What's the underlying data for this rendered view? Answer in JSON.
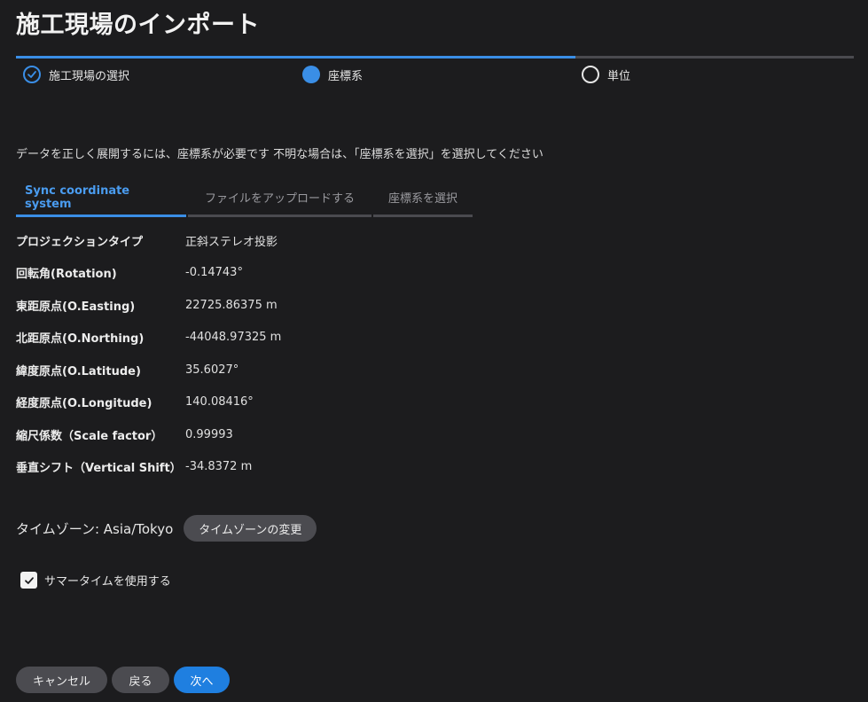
{
  "title": "施工現場のインポート",
  "steps": [
    {
      "label": "施工現場の選択",
      "state": "done"
    },
    {
      "label": "座標系",
      "state": "active"
    },
    {
      "label": "単位",
      "state": "pending"
    }
  ],
  "instruction": "データを正しく展開するには、座標系が必要です 不明な場合は、「座標系を選択」を選択してください",
  "tabs": [
    {
      "label": "Sync coordinate system",
      "active": true
    },
    {
      "label": "ファイルをアップロードする",
      "active": false
    },
    {
      "label": "座標系を選択",
      "active": false
    }
  ],
  "properties": [
    {
      "label": "プロジェクションタイプ",
      "value": "正斜ステレオ投影"
    },
    {
      "label": "回転角(Rotation)",
      "value": "-0.14743°"
    },
    {
      "label": "東距原点(O.Easting)",
      "value": "22725.86375 m"
    },
    {
      "label": "北距原点(O.Northing)",
      "value": "-44048.97325 m"
    },
    {
      "label": "緯度原点(O.Latitude)",
      "value": "35.6027°"
    },
    {
      "label": "経度原点(O.Longitude)",
      "value": "140.08416°"
    },
    {
      "label": "縮尺係数（Scale factor）",
      "value": "0.99993"
    },
    {
      "label": "垂直シフト（Vertical Shift）",
      "value": "-34.8372 m"
    }
  ],
  "timezone": {
    "label": "タイムゾーン: Asia/Tokyo",
    "change_button": "タイムゾーンの変更"
  },
  "dst": {
    "label": "サマータイムを使用する",
    "checked": true
  },
  "footer": {
    "cancel": "キャンセル",
    "back": "戻る",
    "next": "次へ"
  },
  "colors": {
    "accent": "#3a8ee6",
    "background": "#1c1c1e",
    "button": "#4b4b50",
    "primary_button": "#1f7fe0"
  }
}
